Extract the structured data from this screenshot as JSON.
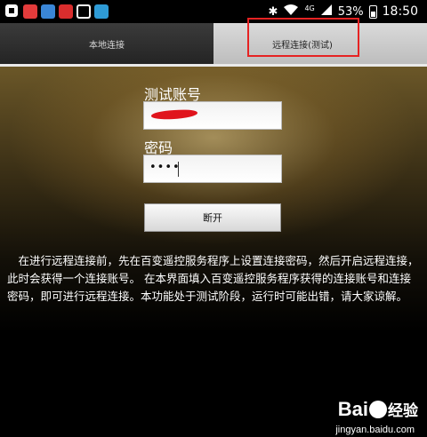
{
  "status_bar": {
    "network": "4G",
    "battery_percent": "53%",
    "time": "18:50",
    "left_icons": [
      "app-icon-gallery",
      "app-icon-red",
      "app-icon-blue",
      "app-icon-red-2",
      "app-icon-screenshot",
      "app-icon-shield"
    ],
    "right_icons": [
      "bluetooth-icon",
      "wifi-icon",
      "signal-icon",
      "battery-icon"
    ]
  },
  "tabs": [
    {
      "label": "本地连接",
      "active": false
    },
    {
      "label": "远程连接(测试)",
      "active": true
    }
  ],
  "form": {
    "account_label": "测试账号",
    "account_value_redacted": true,
    "password_label": "密码",
    "password_value": "••••",
    "disconnect_button": "断开"
  },
  "description": "在进行远程连接前，先在百变遥控服务程序上设置连接密码，然后开启远程连接，此时会获得一个连接账号。 在本界面填入百变遥控服务程序获得的连接账号和连接密码，即可进行远程连接。本功能处于测试阶段，运行时可能出错，请大家谅解。",
  "watermark": {
    "logo_left": "Bai",
    "logo_right": "经验",
    "url": "jingyan.baidu.com"
  },
  "colors": {
    "highlight_box": "#e62222",
    "redaction": "#e0141c"
  }
}
